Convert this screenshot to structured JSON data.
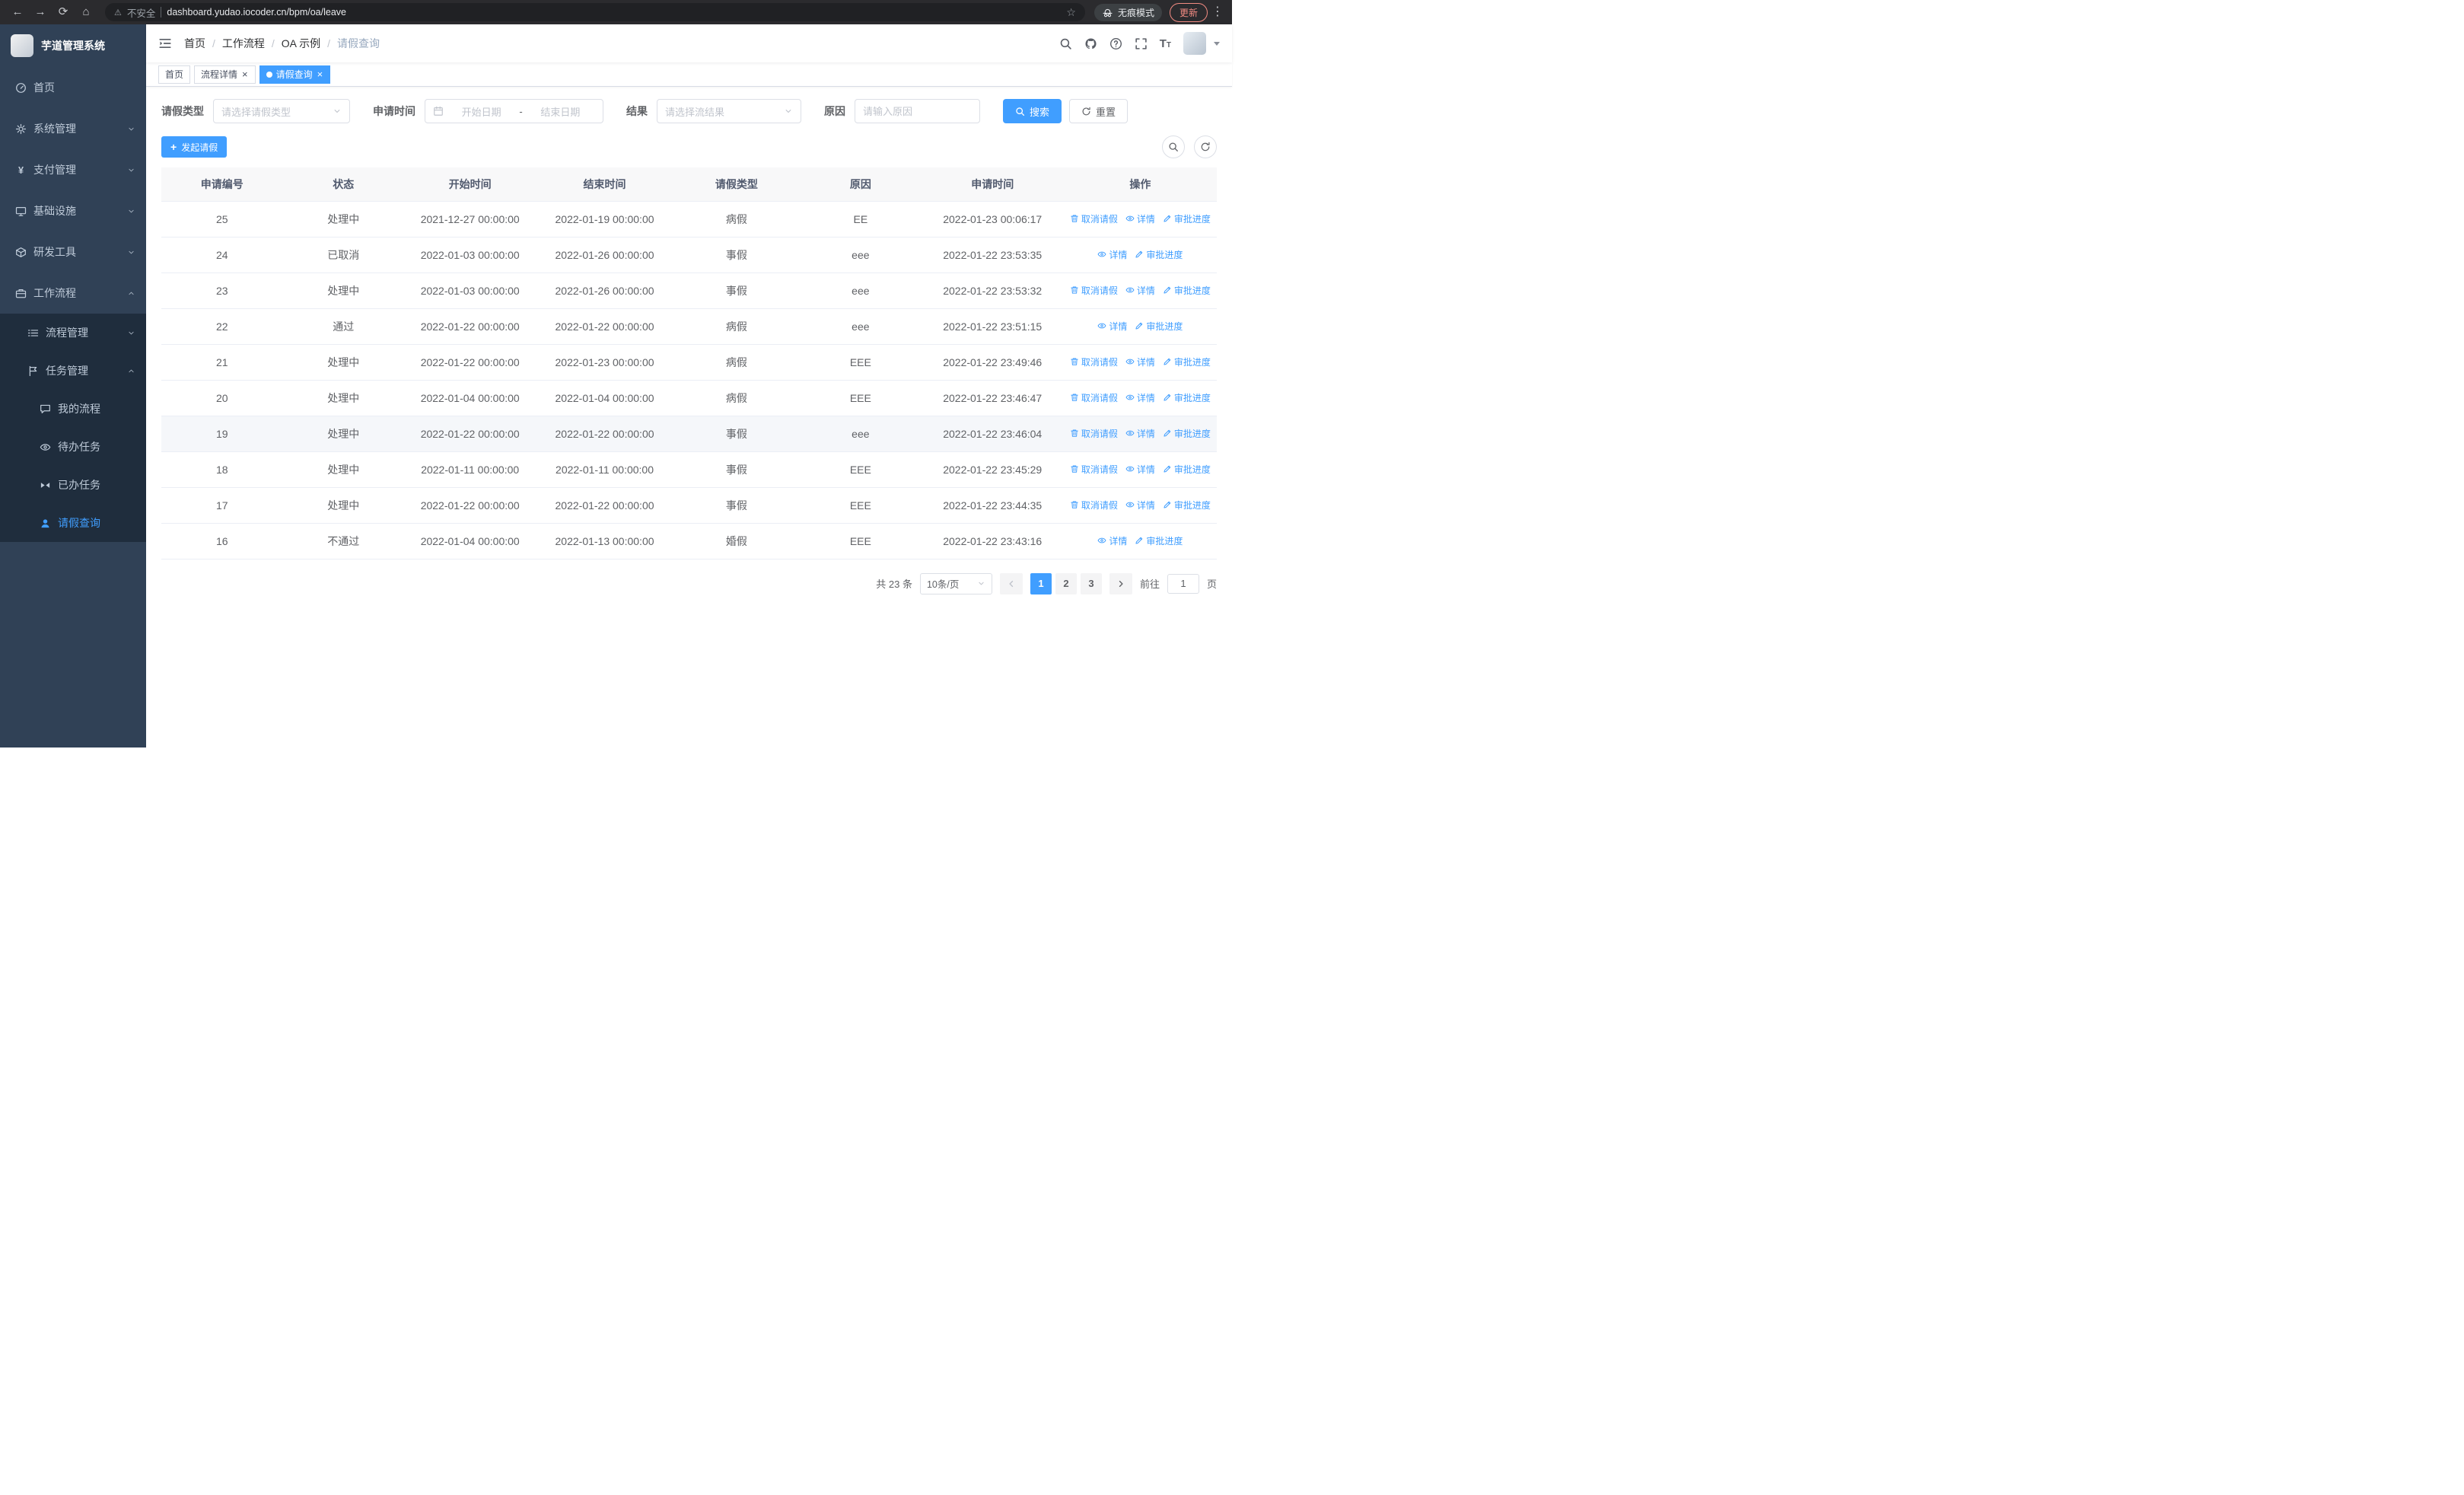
{
  "colors": {
    "accent": "#409eff",
    "sidebar_bg": "#304156",
    "submenu_bg": "#1f2d3d",
    "chrome_bg": "#2b2b2e",
    "update_red": "#f28b82"
  },
  "browser": {
    "security_warning": "不安全",
    "url": "dashboard.yudao.iocoder.cn/bpm/oa/leave",
    "incognito_label": "无痕模式",
    "update_label": "更新"
  },
  "sidebar": {
    "logo_title": "芋道管理系统",
    "menu": [
      {
        "key": "home",
        "label": "首页",
        "icon": "gauge"
      },
      {
        "key": "system",
        "label": "系统管理",
        "icon": "gear",
        "arrow": "down"
      },
      {
        "key": "payment",
        "label": "支付管理",
        "icon": "yen",
        "arrow": "down"
      },
      {
        "key": "infra",
        "label": "基础设施",
        "icon": "monitor",
        "arrow": "down"
      },
      {
        "key": "devtools",
        "label": "研发工具",
        "icon": "box",
        "arrow": "down"
      },
      {
        "key": "workflow",
        "label": "工作流程",
        "icon": "briefcase",
        "arrow": "up",
        "children": [
          {
            "key": "process-mgmt",
            "label": "流程管理",
            "icon": "list",
            "arrow": "down"
          },
          {
            "key": "task-mgmt",
            "label": "任务管理",
            "icon": "flag",
            "arrow": "up",
            "children": [
              {
                "key": "my-process",
                "label": "我的流程",
                "icon": "chat"
              },
              {
                "key": "todo-task",
                "label": "待办任务",
                "icon": "eye"
              },
              {
                "key": "done-task",
                "label": "已办任务",
                "icon": "bowtie"
              },
              {
                "key": "leave-query",
                "label": "请假查询",
                "icon": "user",
                "active": true
              }
            ]
          }
        ]
      }
    ]
  },
  "header": {
    "breadcrumb": [
      "首页",
      "工作流程",
      "OA 示例",
      "请假查询"
    ]
  },
  "tabs": [
    {
      "label": "首页",
      "closable": false,
      "active": false
    },
    {
      "label": "流程详情",
      "closable": true,
      "active": false
    },
    {
      "label": "请假查询",
      "closable": true,
      "active": true
    }
  ],
  "filters": {
    "leave_type_label": "请假类型",
    "leave_type_placeholder": "请选择请假类型",
    "apply_time_label": "申请时间",
    "start_date_placeholder": "开始日期",
    "date_separator": "-",
    "end_date_placeholder": "结束日期",
    "result_label": "结果",
    "result_placeholder": "请选择流结果",
    "reason_label": "原因",
    "reason_placeholder": "请输入原因",
    "search_label": "搜索",
    "reset_label": "重置"
  },
  "toolbar": {
    "create_label": "发起请假"
  },
  "table": {
    "columns": [
      "申请编号",
      "状态",
      "开始时间",
      "结束时间",
      "请假类型",
      "原因",
      "申请时间",
      "操作"
    ],
    "action_labels": {
      "cancel": "取消请假",
      "detail": "详情",
      "progress": "审批进度"
    },
    "rows": [
      {
        "id": "25",
        "status": "处理中",
        "start": "2021-12-27 00:00:00",
        "end": "2022-01-19 00:00:00",
        "type": "病假",
        "reason": "EE",
        "applied": "2022-01-23 00:06:17",
        "actions": [
          "cancel",
          "detail",
          "progress"
        ]
      },
      {
        "id": "24",
        "status": "已取消",
        "start": "2022-01-03 00:00:00",
        "end": "2022-01-26 00:00:00",
        "type": "事假",
        "reason": "eee",
        "applied": "2022-01-22 23:53:35",
        "actions": [
          "detail",
          "progress"
        ]
      },
      {
        "id": "23",
        "status": "处理中",
        "start": "2022-01-03 00:00:00",
        "end": "2022-01-26 00:00:00",
        "type": "事假",
        "reason": "eee",
        "applied": "2022-01-22 23:53:32",
        "actions": [
          "cancel",
          "detail",
          "progress"
        ]
      },
      {
        "id": "22",
        "status": "通过",
        "start": "2022-01-22 00:00:00",
        "end": "2022-01-22 00:00:00",
        "type": "病假",
        "reason": "eee",
        "applied": "2022-01-22 23:51:15",
        "actions": [
          "detail",
          "progress"
        ]
      },
      {
        "id": "21",
        "status": "处理中",
        "start": "2022-01-22 00:00:00",
        "end": "2022-01-23 00:00:00",
        "type": "病假",
        "reason": "EEE",
        "applied": "2022-01-22 23:49:46",
        "actions": [
          "cancel",
          "detail",
          "progress"
        ]
      },
      {
        "id": "20",
        "status": "处理中",
        "start": "2022-01-04 00:00:00",
        "end": "2022-01-04 00:00:00",
        "type": "病假",
        "reason": "EEE",
        "applied": "2022-01-22 23:46:47",
        "actions": [
          "cancel",
          "detail",
          "progress"
        ]
      },
      {
        "id": "19",
        "status": "处理中",
        "start": "2022-01-22 00:00:00",
        "end": "2022-01-22 00:00:00",
        "type": "事假",
        "reason": "eee",
        "applied": "2022-01-22 23:46:04",
        "actions": [
          "cancel",
          "detail",
          "progress"
        ],
        "highlighted": true
      },
      {
        "id": "18",
        "status": "处理中",
        "start": "2022-01-11 00:00:00",
        "end": "2022-01-11 00:00:00",
        "type": "事假",
        "reason": "EEE",
        "applied": "2022-01-22 23:45:29",
        "actions": [
          "cancel",
          "detail",
          "progress"
        ]
      },
      {
        "id": "17",
        "status": "处理中",
        "start": "2022-01-22 00:00:00",
        "end": "2022-01-22 00:00:00",
        "type": "事假",
        "reason": "EEE",
        "applied": "2022-01-22 23:44:35",
        "actions": [
          "cancel",
          "detail",
          "progress"
        ]
      },
      {
        "id": "16",
        "status": "不通过",
        "start": "2022-01-04 00:00:00",
        "end": "2022-01-13 00:00:00",
        "type": "婚假",
        "reason": "EEE",
        "applied": "2022-01-22 23:43:16",
        "actions": [
          "detail",
          "progress"
        ]
      }
    ]
  },
  "pagination": {
    "total_label": "共 23 条",
    "page_size": "10条/页",
    "pages": [
      "1",
      "2",
      "3"
    ],
    "active_page": "1",
    "goto_label": "前往",
    "goto_value": "1",
    "page_label": "页"
  }
}
